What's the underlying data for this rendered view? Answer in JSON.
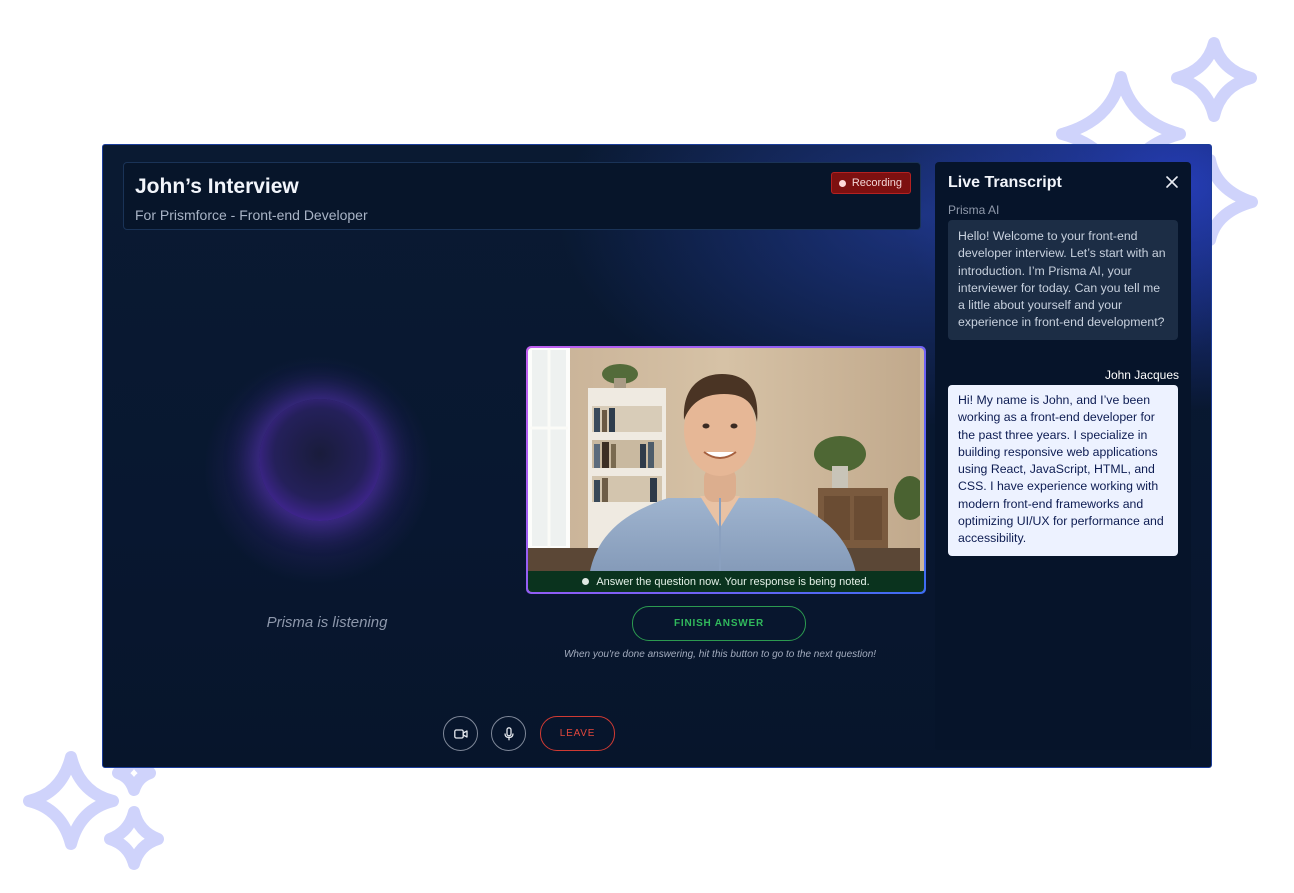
{
  "window": {
    "title": "John’s Interview",
    "subtitle": "For Prismforce - Front-end Developer",
    "recording_label": "Recording"
  },
  "ai": {
    "status_text": "Prisma is listening"
  },
  "video": {
    "note": "Answer the question now. Your response is being noted."
  },
  "answer": {
    "finish_label": "FINISH ANSWER",
    "hint": "When you're done answering, hit this button to go to the next question!"
  },
  "controls": {
    "camera_icon": "video-camera-icon",
    "mic_icon": "microphone-icon",
    "leave_label": "LEAVE"
  },
  "transcript": {
    "title": "Live Transcript",
    "close_icon": "close-icon",
    "messages": [
      {
        "speaker": "Prisma AI",
        "text": "Hello! Welcome to your front-end developer interview. Let’s start with an introduction. I’m Prisma AI, your interviewer for today. Can you tell me a little about yourself and your experience in front-end development?"
      },
      {
        "speaker": "John Jacques",
        "text": "Hi! My name is John, and I’ve been working as a front-end developer for the past three years. I specialize in building responsive web applications using React, JavaScript, HTML, and CSS. I have experience working with modern front-end frameworks and optimizing UI/UX for performance and accessibility."
      }
    ]
  },
  "colors": {
    "accent_purple": "#7c4dff",
    "recording_red": "#7d1010",
    "finish_green": "#31b95c",
    "leave_red": "#e2473d"
  }
}
